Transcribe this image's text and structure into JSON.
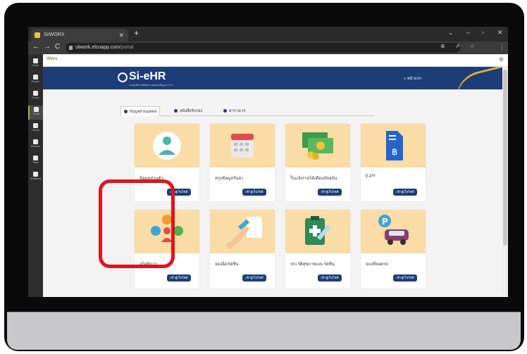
{
  "browser": {
    "tab_title": "SiiWORX",
    "tab_close": "✕",
    "new_tab": "+",
    "url_host": "siiwork.elcoapp.com",
    "url_path": "/portal",
    "back": "←",
    "forward": "→",
    "reload": "C",
    "omni_icons": "⊕ ⇗ ☆",
    "menu": "⋮",
    "win_min": "–",
    "win_max": "▫",
    "win_close": "✕",
    "win_chevron": "⌄"
  },
  "rail": {
    "items": [
      {
        "label": "Home"
      },
      {
        "label": "People"
      },
      {
        "label": "Forms"
      },
      {
        "label": "Portal"
      },
      {
        "label": "Library"
      },
      {
        "label": "Discover"
      },
      {
        "label": "Tasks"
      },
      {
        "label": "Workflows"
      }
    ],
    "active_index": 3
  },
  "app": {
    "logo": "W",
    "logo_suffix": "iorx",
    "gear": "⚙"
  },
  "header": {
    "brand": "Si-eHR",
    "brand_sub": "ระบบบริหารทรัพยากรบุคคลเชิงบูรณาการ",
    "home_link": "หน้าแรก",
    "home_icon": "⌂"
  },
  "tabs": [
    {
      "label": "ข้อมูลส่วนบุคคล",
      "active": true
    },
    {
      "label": "หนังสือรับรอง",
      "active": false
    },
    {
      "label": "ตารางเวร",
      "active": false
    }
  ],
  "cards": [
    {
      "title": "ข้อมูลส่วนตัว",
      "button": "เข้าสู่เว็บไซต์",
      "icon": "person-icon"
    },
    {
      "title": "สรุปข้อมูลวันลา",
      "button": "เข้าสู่เว็บไซต์",
      "icon": "calendar-icon"
    },
    {
      "title": "ใบแจ้งรายได้เดือนปัจจุบัน",
      "button": "เข้าสู่เว็บไซต์",
      "icon": "money-icon"
    },
    {
      "title": "E-PY",
      "button": "เข้าสู่เว็บไซต์",
      "icon": "baht-document-icon"
    },
    {
      "title": "สวัสดิการ",
      "button": "เข้าสู่เว็บไซต์",
      "icon": "welfare-icon"
    },
    {
      "title": "จองฉีดวัคซีน",
      "button": "เข้าสู่เว็บไซต์",
      "icon": "vaccine-icon"
    },
    {
      "title": "ประวัติสุขภาพและวัคซีน",
      "button": "เข้าสู่เว็บไซต์",
      "icon": "health-record-icon"
    },
    {
      "title": "จองที่จอดรถ",
      "button": "เข้าสู่เว็บไซต์",
      "icon": "parking-icon"
    }
  ],
  "colors": {
    "brand_blue": "#1c3d78",
    "card_art": "#f9dca6",
    "highlight": "#e0141e",
    "accent_gold": "#d8b13b"
  }
}
